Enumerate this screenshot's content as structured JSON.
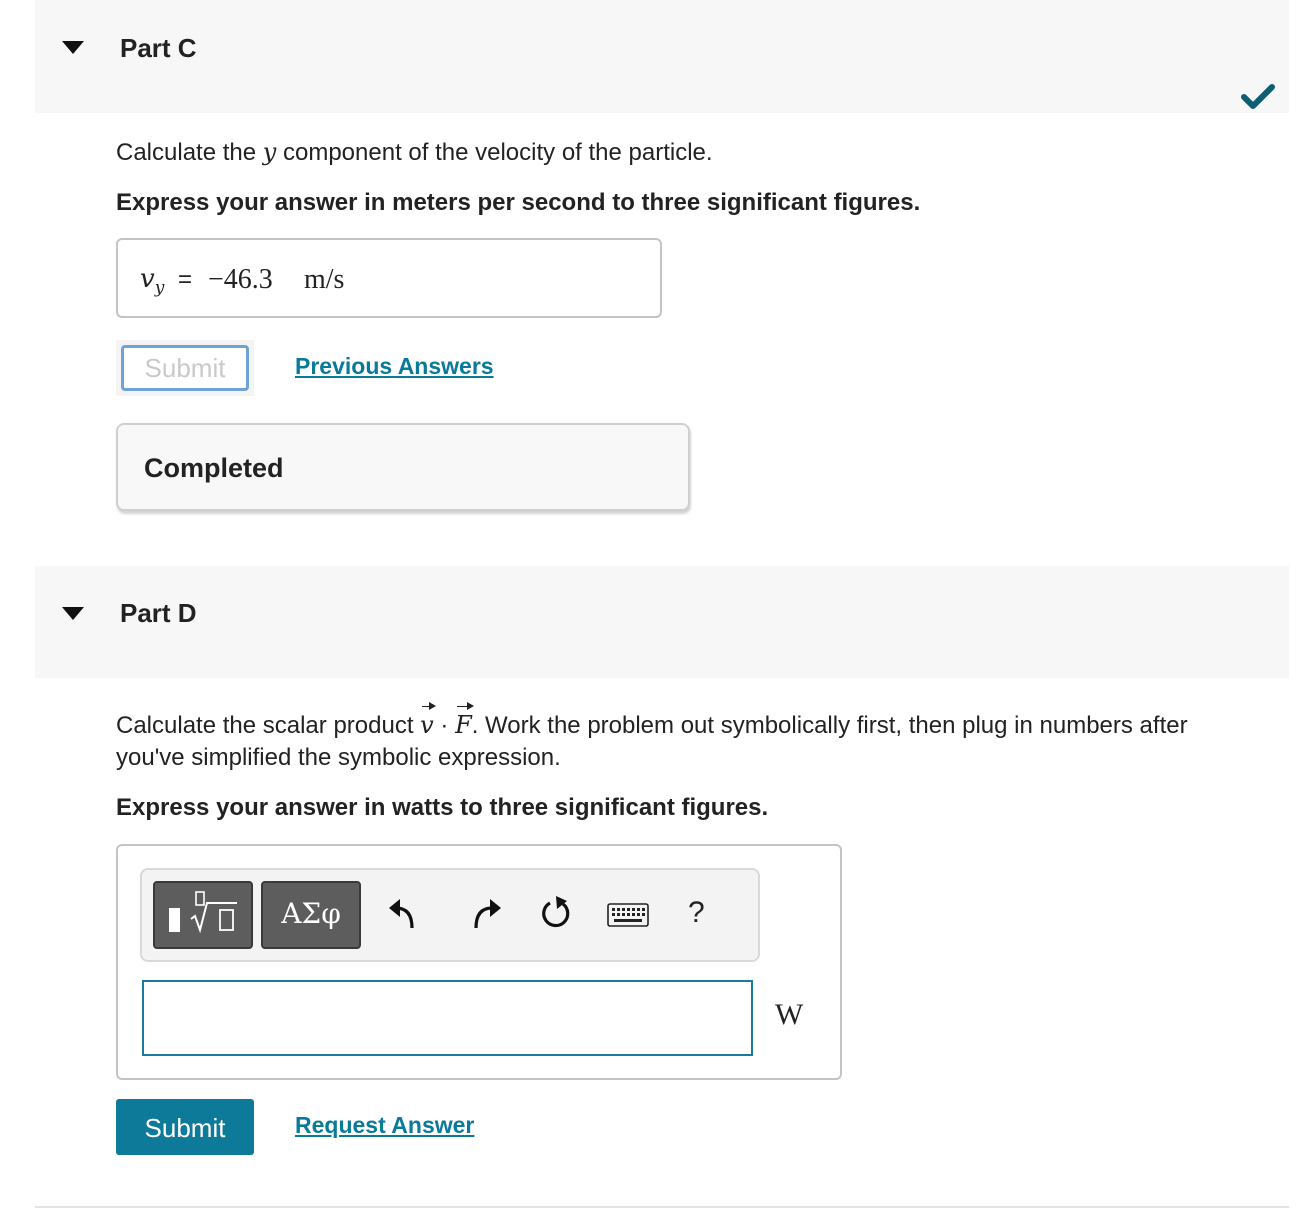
{
  "partC": {
    "title": "Part C",
    "question": "Calculate the y component of the velocity of the particle.",
    "question_pre": "Calculate the ",
    "question_var": "y",
    "question_post": " component of the velocity of the particle.",
    "instruction": "Express your answer in meters per second to three significant figures.",
    "answer": {
      "variable": "v",
      "subscript": "y",
      "equals": "=",
      "value": "−46.3",
      "unit": "m/s"
    },
    "submit_label": "Submit",
    "previous_answers_label": "Previous Answers",
    "status": "Completed"
  },
  "partD": {
    "title": "Part D",
    "question_pre": "Calculate the scalar product ",
    "question_v": "v",
    "question_dot": " · ",
    "question_F": "F",
    "question_post": ". Work the problem out symbolically first, then plug in numbers after",
    "question_line2": "you've simplified the symbolic expression.",
    "instruction": "Express your answer in watts to three significant figures.",
    "toolbar": {
      "greek_label": "ΑΣφ",
      "help_label": "?"
    },
    "input_value": "",
    "unit": "W",
    "submit_label": "Submit",
    "request_answer_label": "Request Answer"
  },
  "colors": {
    "accent": "#0e7a99",
    "link": "#097a9a",
    "check": "#0d5e73"
  }
}
